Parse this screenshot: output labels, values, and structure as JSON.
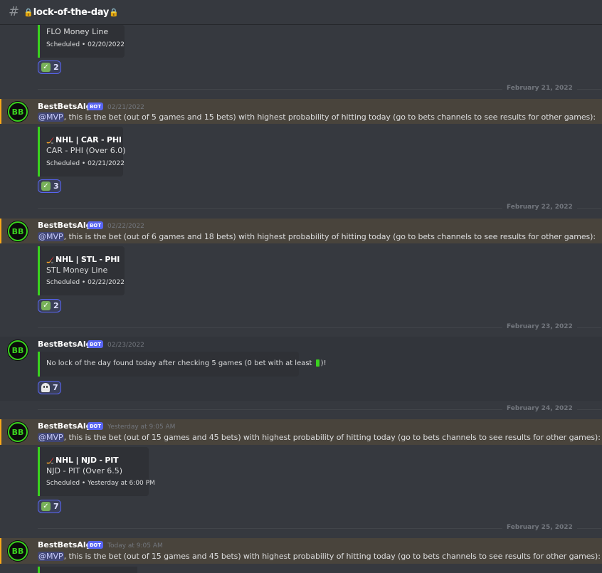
{
  "channel": {
    "prefix_icon": "hash-icon",
    "name": "lock-of-the-day",
    "lock_icon": "lock-icon"
  },
  "bot_tag": "BOT",
  "mention": "@MVP",
  "first_embed": {
    "pick": "FLO Money Line",
    "footer": "Scheduled • 02/20/2022"
  },
  "first_reaction": {
    "emoji": "check-icon",
    "count": "2"
  },
  "messages": [
    {
      "date_divider": "February 21, 2022",
      "author": "BestBetsAlgo",
      "timestamp": "02/21/2022",
      "text": ", this is the bet (out of 5 games and 15 bets) with highest probability of hitting today (go to bets channels to see results for other games):",
      "embed": {
        "title": "NHL | CAR - PHI",
        "pick": "CAR - PHI (Over 6.0)",
        "footer": "Scheduled • 02/21/2022"
      },
      "reaction": {
        "emoji": "check-icon",
        "count": "3"
      }
    },
    {
      "date_divider": "February 22, 2022",
      "author": "BestBetsAlgo",
      "timestamp": "02/22/2022",
      "text": ", this is the bet (out of 6 games and 18 bets) with highest probability of hitting today (go to bets channels to see results for other games):",
      "embed": {
        "title": "NHL | STL - PHI",
        "pick": "STL Money Line",
        "footer": "Scheduled • 02/22/2022"
      },
      "reaction": {
        "emoji": "check-icon",
        "count": "2"
      }
    },
    {
      "date_divider": "February 23, 2022",
      "author": "BestBetsAlgo",
      "timestamp": "02/23/2022",
      "embed": {
        "text_before": "No lock of the day found today after checking 5 games (0 bet with at least ",
        "text_after": ")!"
      },
      "reaction": {
        "emoji": "ghost-icon",
        "count": "7"
      }
    },
    {
      "date_divider": "February 24, 2022",
      "author": "BestBetsAlgo",
      "timestamp": "Yesterday at 9:05 AM",
      "text": ", this is the bet (out of 15 games and 45 bets) with highest probability of hitting today (go to bets channels to see results for other games):",
      "embed": {
        "title": "NHL | NJD - PIT",
        "pick": "NJD - PIT (Over 6.5)",
        "footer": "Scheduled • Yesterday at 6:00 PM"
      },
      "reaction": {
        "emoji": "check-icon",
        "count": "7"
      }
    },
    {
      "date_divider": "February 25, 2022",
      "author": "BestBetsAlgo",
      "timestamp": "Today at 9:05 AM",
      "text": ", this is the bet (out of 15 games and 45 bets) with highest probability of hitting today (go to bets channels to see results for other games):"
    }
  ]
}
